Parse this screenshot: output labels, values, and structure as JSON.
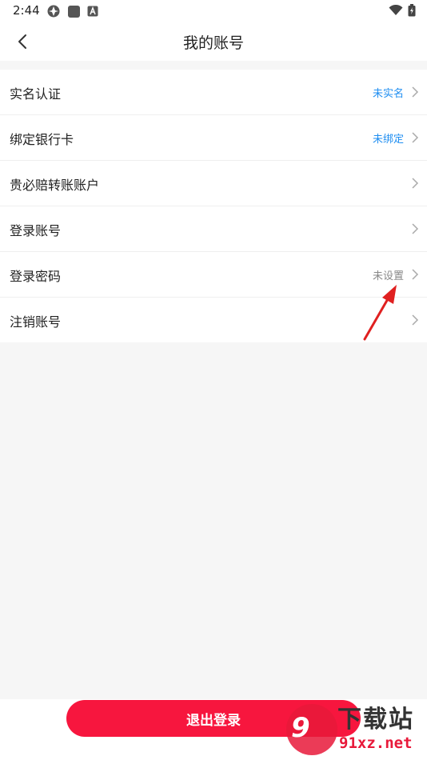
{
  "status_bar": {
    "time": "2:44"
  },
  "header": {
    "title": "我的账号"
  },
  "menu": {
    "items": [
      {
        "label": "实名认证",
        "value": "未实名",
        "value_color": "#1f8ef1"
      },
      {
        "label": "绑定银行卡",
        "value": "未绑定",
        "value_color": "#1f8ef1"
      },
      {
        "label": "贵必赔转账账户",
        "value": ""
      },
      {
        "label": "登录账号",
        "value": ""
      },
      {
        "label": "登录密码",
        "value": "未设置",
        "value_color": "#888888"
      },
      {
        "label": "注销账号",
        "value": ""
      }
    ]
  },
  "footer": {
    "logout_label": "退出登录"
  },
  "watermark": {
    "number": "9",
    "title": "下载站",
    "domain": "91xz.net"
  },
  "colors": {
    "accent": "#f7163e",
    "link_blue": "#1f8ef1",
    "arrow": "#e02020"
  }
}
